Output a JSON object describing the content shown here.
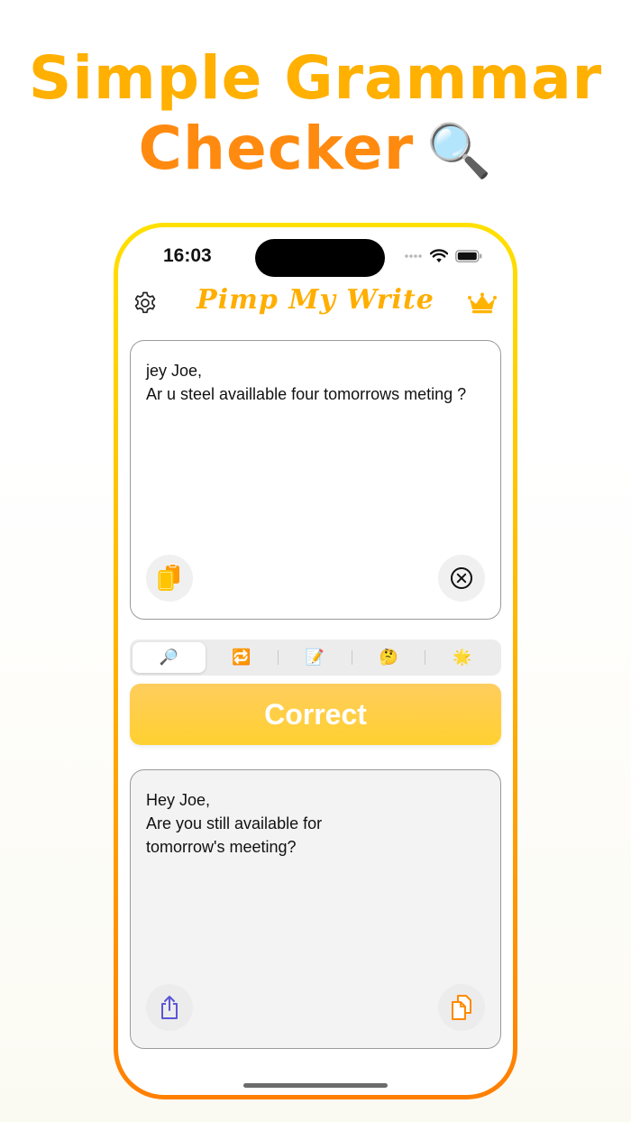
{
  "promo": {
    "line1": "Simple Grammar",
    "line2": "Checker",
    "line2_emoji": "🔍"
  },
  "status_bar": {
    "time": "16:03"
  },
  "header": {
    "title": "Pimp My Write",
    "left_icon": "gear-icon",
    "right_icon": "crown-icon"
  },
  "input": {
    "lines": [
      "jey Joe,",
      "Ar u steel availlable four tomorrows meting ?"
    ],
    "left_button_icon": "paste-icon",
    "right_button_icon": "clear-icon"
  },
  "modes": {
    "items": [
      {
        "icon": "magnifier-icon",
        "glyph": "🔎",
        "selected": true
      },
      {
        "icon": "repeat-icon",
        "glyph": "🔁",
        "selected": false
      },
      {
        "icon": "memo-icon",
        "glyph": "📝",
        "selected": false
      },
      {
        "icon": "thinking-icon",
        "glyph": "🤔",
        "selected": false
      },
      {
        "icon": "sparkle-star-icon",
        "glyph": "🌟",
        "selected": false
      }
    ]
  },
  "action": {
    "correct_label": "Correct"
  },
  "output": {
    "lines": [
      "Hey Joe,",
      "Are you still available for",
      "tomorrow's meeting?"
    ],
    "left_button_icon": "share-icon",
    "right_button_icon": "copy-icon"
  },
  "colors": {
    "accent_yellow": "#ffb000",
    "accent_orange": "#ff8a10",
    "button_yellow": "#ffd030",
    "share_purple": "#5b55d6"
  }
}
